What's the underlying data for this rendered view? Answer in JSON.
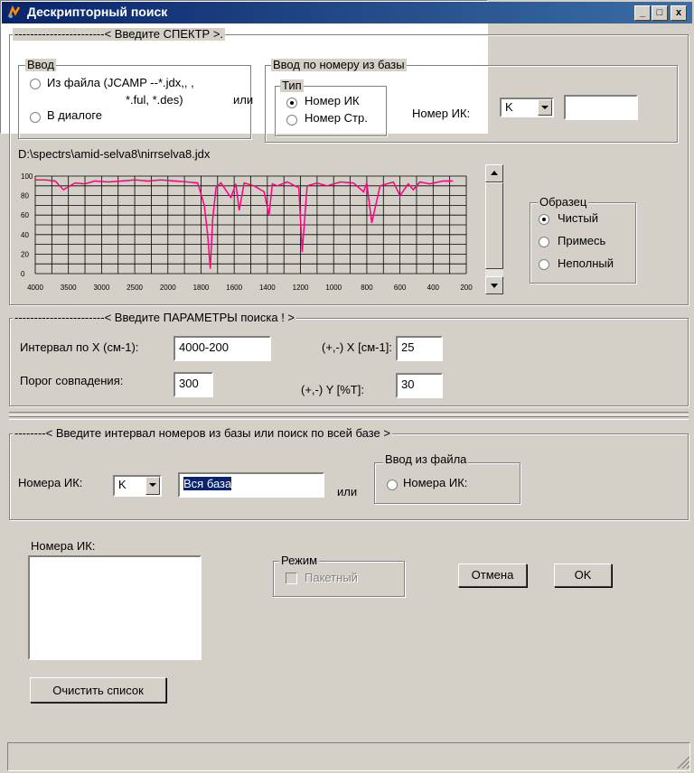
{
  "window": {
    "title": "Дескрипторный поиск",
    "buttons": [
      "_",
      "□",
      "x"
    ]
  },
  "spectrum_section": {
    "header": "-----------------------< Введите СПЕКТР >.",
    "input_group": {
      "legend": "Ввод",
      "from_file_label": "Из файла (JCAMP --*.jdx,, ,",
      "from_file_label2": "*.ful, *.des)",
      "dialog_label": "В диалоге",
      "selected": "none"
    },
    "or_label": "или",
    "db_group": {
      "legend": "Ввод по номеру из базы",
      "type_legend": "Тип",
      "type_ir": "Номер ИК",
      "type_page": "Номер Стр.",
      "selected": "Номер ИК",
      "ir_number_label": "Номер ИК:",
      "ir_combo_value": "K",
      "ir_number_value": ""
    },
    "file_path": "D:\\spectrs\\amid-selva8\\nirrselva8.jdx",
    "sample_group": {
      "legend": "Образец",
      "options": [
        "Чистый",
        "Примесь",
        "Неполный"
      ],
      "selected": "Чистый"
    }
  },
  "chart_data": {
    "type": "line",
    "title": "",
    "xlabel": "",
    "ylabel": "",
    "x_ticks": [
      "4000",
      "3500",
      "3000",
      "2500",
      "2000",
      "1800",
      "1600",
      "1400",
      "1200",
      "1000",
      "800",
      "600",
      "400",
      "200"
    ],
    "y_ticks": [
      "100",
      "80",
      "60",
      "40",
      "20",
      "0"
    ],
    "ylim": [
      0,
      100
    ],
    "grid": true,
    "line_color": "#ff0080",
    "series": [
      {
        "name": "",
        "x_index": [
          0,
          0.3,
          0.6,
          0.85,
          1.0,
          1.2,
          1.5,
          1.8,
          2.2,
          2.6,
          3.0,
          3.4,
          3.8,
          4.2,
          4.6,
          4.9,
          5.1,
          5.2,
          5.28,
          5.35,
          5.45,
          5.6,
          5.9,
          6.05,
          6.15,
          6.3,
          6.6,
          6.9,
          7.05,
          7.15,
          7.3,
          7.6,
          7.95,
          8.05,
          8.2,
          8.5,
          8.8,
          9.2,
          9.6,
          9.9,
          10.0,
          10.15,
          10.4,
          10.8,
          11.0,
          11.25,
          11.4,
          11.6,
          11.9,
          12.3,
          12.6
        ],
        "values": [
          96,
          96,
          95,
          86,
          89,
          93,
          92,
          95,
          94,
          95,
          96,
          95,
          96,
          95,
          94,
          93,
          70,
          40,
          5,
          55,
          88,
          93,
          78,
          92,
          65,
          93,
          90,
          84,
          60,
          92,
          90,
          94,
          88,
          22,
          90,
          93,
          90,
          94,
          93,
          84,
          93,
          52,
          90,
          94,
          80,
          92,
          86,
          94,
          92,
          95,
          95
        ]
      }
    ]
  },
  "params_section": {
    "header": "-----------------------< Введите ПАРАМЕТРЫ поиска ! >",
    "x_interval_label": "Интервал по X (см-1):",
    "x_interval_value": "4000-200",
    "x_tol_label": "(+,-) X [см-1]:",
    "x_tol_value": "25",
    "threshold_label": "Порог совпадения:",
    "threshold_value": "300",
    "y_tol_label": "(+,-) Y [%T]:",
    "y_tol_value": "30"
  },
  "range_section": {
    "header": "--------< Введите интервал номеров из базы или поиск по всей базе >",
    "ir_numbers_label": "Номера ИК:",
    "ir_combo_value": "K",
    "range_value": "Вся база",
    "or_label": "или",
    "file_group_legend": "Ввод из файла",
    "file_radio_label": "Номера ИК:"
  },
  "results_section": {
    "list_label": "Номера ИК:",
    "mode_legend": "Режим",
    "batch_label": "Пакетный",
    "cancel_label": "Отмена",
    "ok_label": "OK",
    "clear_label": "Очистить список"
  }
}
